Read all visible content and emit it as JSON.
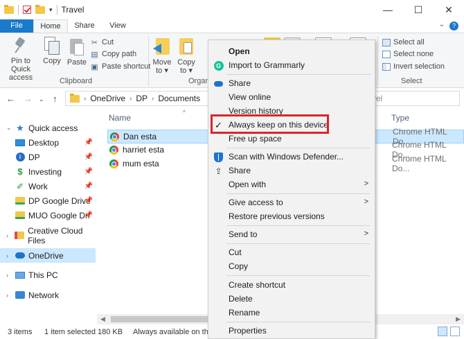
{
  "window": {
    "title": "Travel",
    "controls": {
      "minimize": "—",
      "maximize": "☐",
      "close": "✕"
    }
  },
  "ribbon_tabs": [
    "File",
    "Home",
    "Share",
    "View"
  ],
  "ribbon": {
    "clipboard": {
      "pin": "Pin to Quick\naccess",
      "copy": "Copy",
      "paste": "Paste",
      "cut": "Cut",
      "copy_path": "Copy path",
      "paste_shortcut": "Paste shortcut",
      "label": "Clipboard"
    },
    "organize": {
      "move_to": "Move\nto ▾",
      "copy_to": "Copy\nto ▾",
      "label": "Organi"
    },
    "select": {
      "select_all": "Select all",
      "select_none": "Select none",
      "invert": "Invert selection",
      "label": "Select"
    }
  },
  "address": {
    "crumbs": [
      "OneDrive",
      "DP",
      "Documents"
    ],
    "search_partial": "vel"
  },
  "nav": {
    "items": [
      {
        "label": "Quick access",
        "icon": "star-icon",
        "pinned": false
      },
      {
        "label": "Desktop",
        "icon": "desktop-icon",
        "pinned": true
      },
      {
        "label": "DP",
        "icon": "dp-icon",
        "pinned": true
      },
      {
        "label": "Investing",
        "icon": "dollar-icon",
        "pinned": true
      },
      {
        "label": "Work",
        "icon": "work-icon",
        "pinned": true
      },
      {
        "label": "DP Google Drive",
        "icon": "gdrive-folder-icon",
        "pinned": true
      },
      {
        "label": "MUO Google Dri",
        "icon": "gdrive-folder-icon",
        "pinned": true
      },
      {
        "label": "Creative Cloud Files",
        "icon": "creative-cloud-icon",
        "pinned": false
      },
      {
        "label": "OneDrive",
        "icon": "onedrive-cloud-icon",
        "pinned": false
      },
      {
        "label": "This PC",
        "icon": "pc-icon",
        "pinned": false
      },
      {
        "label": "Network",
        "icon": "network-icon",
        "pinned": false
      }
    ],
    "pin_glyph": "📌"
  },
  "files": {
    "col_name": "Name",
    "col_type": "Type",
    "rows": [
      {
        "name": "Dan esta",
        "type": "Chrome HTML Do..."
      },
      {
        "name": "harriet esta",
        "type": "Chrome HTML Do..."
      },
      {
        "name": "mum esta",
        "type": "Chrome HTML Do..."
      }
    ]
  },
  "status": {
    "items": "3 items",
    "selected": "1 item selected",
    "size": "180 KB",
    "availability": "Always available on thi"
  },
  "context_menu": {
    "items": [
      {
        "label": "Open",
        "bold": true
      },
      {
        "label": "Import to Grammarly",
        "icon": "grammarly-icon"
      },
      {
        "label": "Share",
        "icon": "onedrive-cloud-icon"
      },
      {
        "label": "View online"
      },
      {
        "label": "Version history"
      },
      {
        "label": "Always keep on this device",
        "icon": "check-icon"
      },
      {
        "label": "Free up space"
      },
      {
        "label": "Scan with Windows Defender...",
        "icon": "defender-shield-icon"
      },
      {
        "label": "Share",
        "icon": "share-icon"
      },
      {
        "label": "Open with",
        "submenu": true
      },
      {
        "label": "Give access to",
        "submenu": true
      },
      {
        "label": "Restore previous versions"
      },
      {
        "label": "Send to",
        "submenu": true
      },
      {
        "label": "Cut"
      },
      {
        "label": "Copy"
      },
      {
        "label": "Create shortcut"
      },
      {
        "label": "Delete"
      },
      {
        "label": "Rename"
      },
      {
        "label": "Properties"
      }
    ]
  },
  "colors": {
    "accent": "#1979ca",
    "selection": "#cce8ff",
    "highlight_border": "#d9252b"
  }
}
